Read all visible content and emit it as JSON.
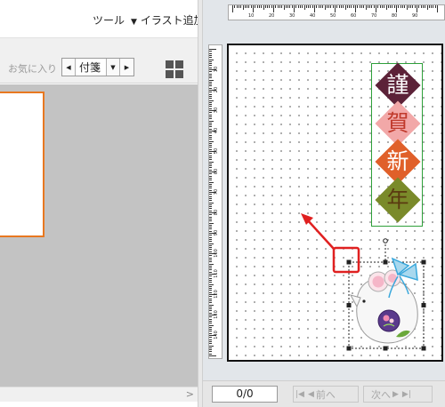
{
  "menu": {
    "tools": "ツール",
    "illust_add": "イラスト追加"
  },
  "toolbar": {
    "favorites": "お気に入り",
    "tag_value": "付箋"
  },
  "rulers": {
    "top_labels": [
      "10",
      "20",
      "30",
      "40",
      "50",
      "60",
      "70",
      "80",
      "90"
    ],
    "left_labels": [
      "10",
      "20",
      "30",
      "40",
      "50",
      "60",
      "70",
      "80",
      "90",
      "100",
      "110",
      "120",
      "130",
      "140"
    ]
  },
  "greeting": {
    "kanji": [
      "謹",
      "賀",
      "新",
      "年"
    ],
    "colors": [
      "#5c2238",
      "#f2a8a8",
      "#e0602a",
      "#7a8a2a"
    ],
    "text_colors": [
      "#ffffff",
      "#c0392b",
      "#ffffff",
      "#5a3a10"
    ]
  },
  "page_nav": {
    "page": "0/0",
    "prev": "前へ",
    "next": "次へ"
  }
}
